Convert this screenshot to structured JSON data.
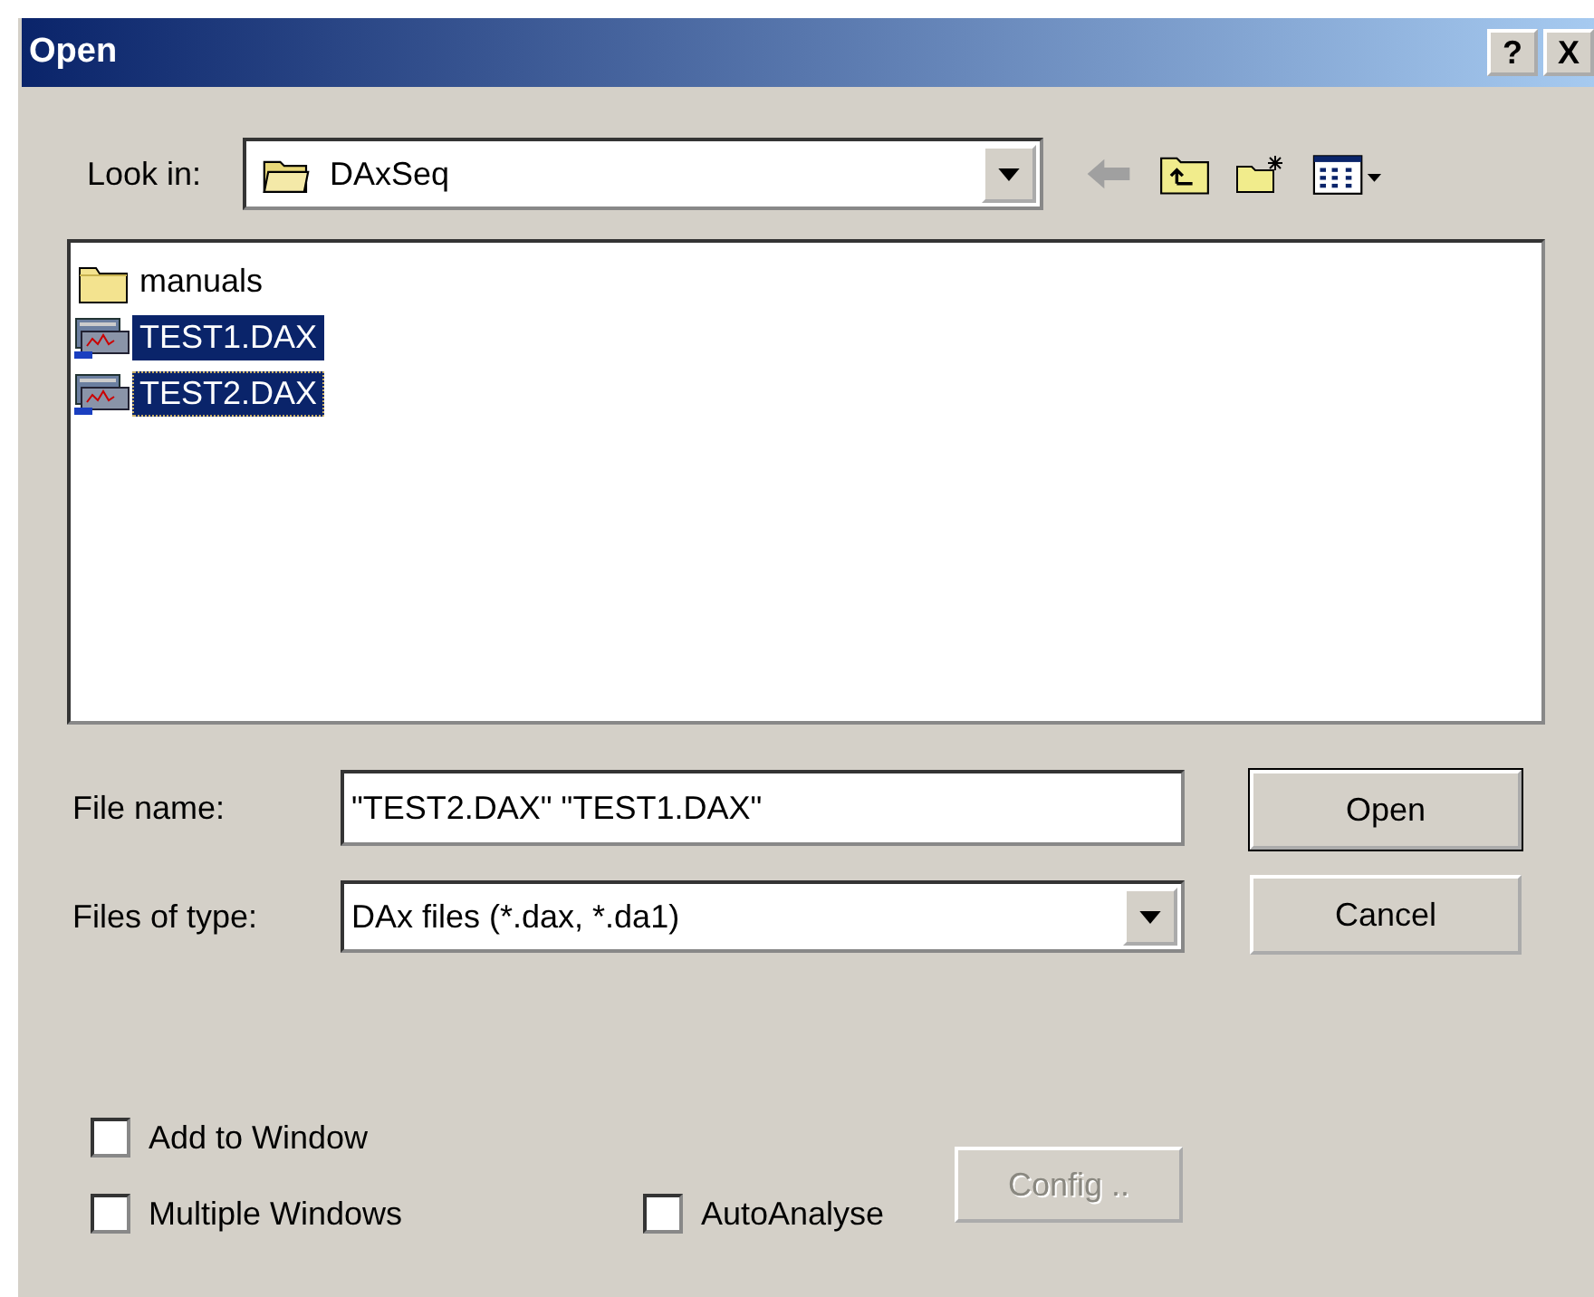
{
  "window": {
    "title": "Open",
    "title_buttons": [
      {
        "kind": "help",
        "label": "?"
      },
      {
        "kind": "close",
        "label": "X"
      }
    ]
  },
  "look_in": {
    "label": "Look in:",
    "value": "DAxSeq"
  },
  "toolbar": [
    {
      "kind": "back"
    },
    {
      "kind": "up"
    },
    {
      "kind": "new-folder"
    },
    {
      "kind": "view"
    }
  ],
  "files": [
    {
      "kind": "folder",
      "name": "manuals",
      "selected": false,
      "focused": false
    },
    {
      "kind": "dax",
      "name": "TEST1.DAX",
      "selected": true,
      "focused": false
    },
    {
      "kind": "dax",
      "name": "TEST2.DAX",
      "selected": true,
      "focused": true
    }
  ],
  "file_name": {
    "label": "File name:",
    "value": "\"TEST2.DAX\" \"TEST1.DAX\""
  },
  "file_type": {
    "label": "Files of type:",
    "value": "DAx files (*.dax, *.da1)"
  },
  "buttons": [
    {
      "label": "Open",
      "default": true,
      "disabled": false
    },
    {
      "label": "Cancel",
      "default": false,
      "disabled": false
    }
  ],
  "options": [
    {
      "label": "Add to Window",
      "checked": false
    },
    {
      "label": "Multiple Windows",
      "checked": false
    },
    {
      "label": "AutoAnalyse",
      "checked": false
    }
  ],
  "config_button": {
    "label": "Config ..",
    "disabled": true
  }
}
